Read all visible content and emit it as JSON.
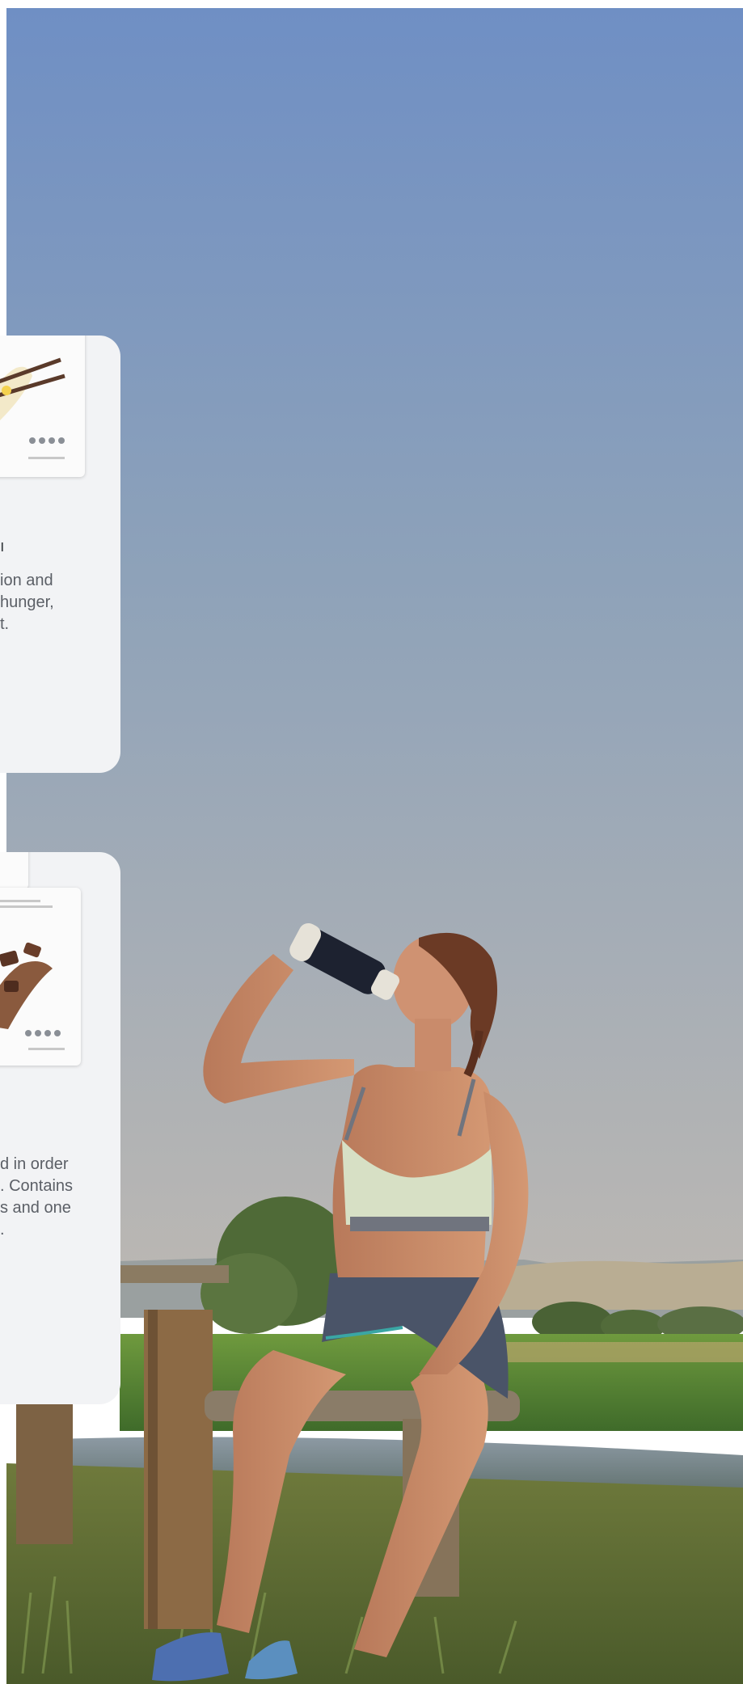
{
  "card_1": {
    "title_fragment": "ı",
    "lines": [
      "ion and",
      "hunger,",
      "",
      "t."
    ]
  },
  "card_2": {
    "lines": [
      "d in order",
      ". Contains",
      "s and one",
      "."
    ]
  },
  "colors": {
    "sky_top": "#6f8fc4",
    "sky_bottom": "#b4b6b8",
    "card_bg": "#f2f3f5",
    "card_text": "#5b5f66",
    "grass": "#5d8a3a"
  }
}
